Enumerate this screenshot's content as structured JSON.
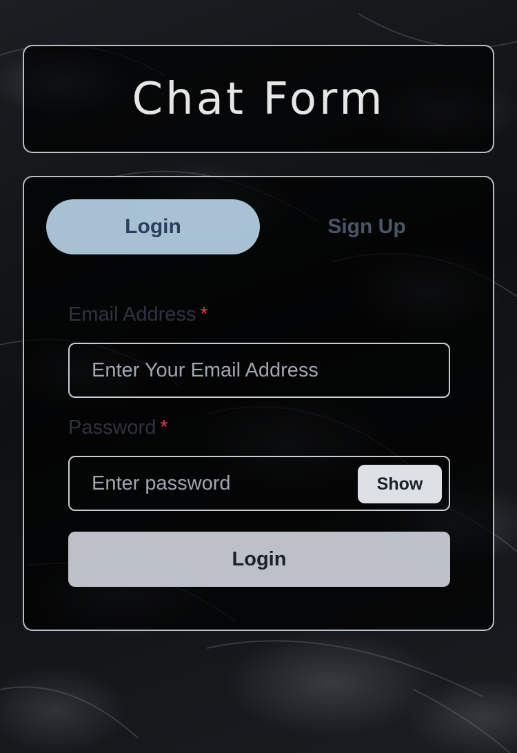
{
  "header": {
    "title": "Chat Form"
  },
  "tabs": [
    {
      "label": "Login",
      "active": true
    },
    {
      "label": "Sign Up",
      "active": false
    }
  ],
  "form": {
    "email": {
      "label": "Email Address",
      "required_marker": "*",
      "placeholder": "Enter Your Email Address",
      "value": ""
    },
    "password": {
      "label": "Password",
      "required_marker": "*",
      "placeholder": "Enter password",
      "value": "",
      "toggle_label": "Show"
    },
    "submit_label": "Login"
  },
  "colors": {
    "active_tab_bg": "#bedcf0",
    "active_tab_text": "#2a3f5f",
    "required_marker": "#e53e3e",
    "card_border": "#dce1e6"
  }
}
